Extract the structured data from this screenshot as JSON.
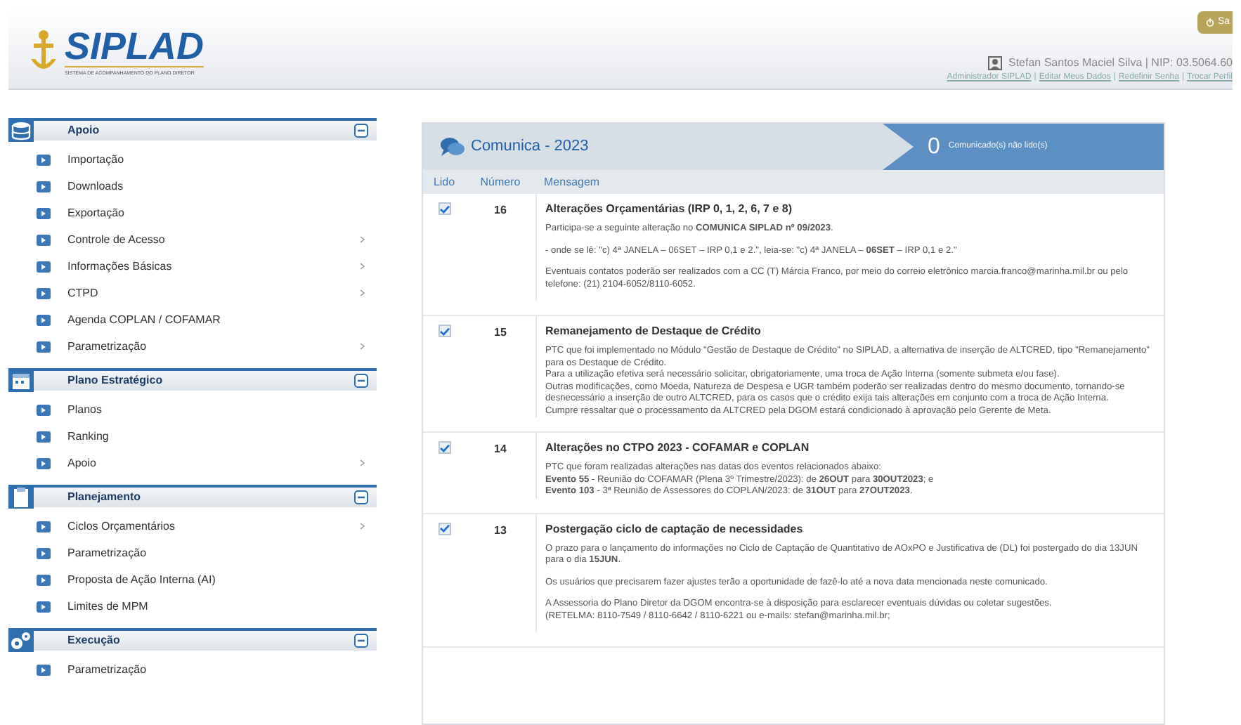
{
  "header": {
    "logo": "SIPLAD",
    "logo_subtitle": "SISTEMA DE ACOMPANHAMENTO DO PLANO DIRETOR",
    "user": "Stefan Santos Maciel Silva | NIP: 03.5064.60",
    "links": [
      "Administrador SIPLAD",
      "Editar Meus Dados",
      "Redefinir Senha",
      "Trocar Perfil"
    ],
    "link_separators": [
      "|",
      "|",
      "|"
    ],
    "exit_button": "Sa"
  },
  "sidebar": {
    "sections": [
      {
        "title": "Apoio",
        "expanded": true,
        "items": [
          {
            "label": "Importação",
            "has_submenu": false
          },
          {
            "label": "Downloads",
            "has_submenu": false
          },
          {
            "label": "Exportação",
            "has_submenu": false
          },
          {
            "label": "Controle de Acesso",
            "has_submenu": true
          },
          {
            "label": "Informações Básicas",
            "has_submenu": true
          },
          {
            "label": "CTPD",
            "has_submenu": true
          },
          {
            "label": "Agenda COPLAN / COFAMAR",
            "has_submenu": false
          },
          {
            "label": "Parametrização",
            "has_submenu": true
          }
        ]
      },
      {
        "title": "Plano Estratégico",
        "expanded": true,
        "items": [
          {
            "label": "Planos",
            "has_submenu": false
          },
          {
            "label": "Ranking",
            "has_submenu": false
          },
          {
            "label": "Apoio",
            "has_submenu": true
          }
        ]
      },
      {
        "title": "Planejamento",
        "expanded": true,
        "items": [
          {
            "label": "Ciclos Orçamentários",
            "has_submenu": true
          },
          {
            "label": "Parametrização",
            "has_submenu": false
          },
          {
            "label": "Proposta de Ação Interna (AI)",
            "has_submenu": false
          },
          {
            "label": "Limites de MPM",
            "has_submenu": false
          }
        ]
      },
      {
        "title": "Execução",
        "expanded": true,
        "items": [
          {
            "label": "Parametrização",
            "has_submenu": false
          }
        ]
      }
    ]
  },
  "panel": {
    "title": "Comunica - 2023",
    "unread_count": "0",
    "unread_label": "Comunicado(s) não lido(s)",
    "columns": [
      "Lido",
      "Número",
      "Mensagem"
    ],
    "rows": [
      {
        "read": true,
        "number": "16",
        "title": "Alterações Orçamentárias (IRP 0, 1, 2, 6, 7 e 8)",
        "spaced": true,
        "paragraphs": [
          "Participa-se a seguinte alteração no **COMUNICA SIPLAD nº 09/2023**.",
          "- onde se lê: \"c) 4ª JANELA – 06SET – IRP 0,1 e 2.\", leia-se: \"c) 4ª JANELA – **06SET** – IRP 0,1 e 2.\"",
          "Eventuais contatos poderão ser realizados com a CC (T) Márcia Franco, por meio do correio eletrônico marcia.franco@marinha.mil.br ou pelo telefone: (21) 2104-6052/8110-6052."
        ]
      },
      {
        "read": true,
        "number": "15",
        "title": "Remanejamento de Destaque de Crédito",
        "spaced": false,
        "paragraphs": [
          "PTC que foi implementado no Módulo \"Gestão de Destaque de Crédito\" no SIPLAD, a alternativa de inserção de ALTCRED, tipo \"Remanejamento\" para os Destaque de Crédito.",
          "Para a utilização efetiva será necessário solicitar, obrigatoriamente, uma troca de Ação Interna (somente submeta e/ou fase).",
          "Outras modificações, como Moeda, Natureza de Despesa e UGR também poderão ser realizadas dentro do mesmo documento, tornando-se desnecessário a inserção de outro  ALTCRED, para os casos que o crédito exija tais alterações em conjunto com a troca de Ação Interna.",
          "Cumpre ressaltar que o processamento da ALTCRED pela DGOM estará condicionado à aprovação pelo Gerente de Meta."
        ]
      },
      {
        "read": true,
        "number": "14",
        "title": "Alterações no CTPO 2023 - COFAMAR e COPLAN",
        "spaced": false,
        "paragraphs": [
          "PTC que foram realizadas alterações nas datas dos eventos relacionados abaixo:",
          "**Evento 55** - Reunião do COFAMAR (Plena 3º Trimestre/2023): de **26OUT** para **30OUT2023**; e",
          "**Evento 103** - 3ª Reunião de Assessores do COPLAN/2023: de **31OUT** para **27OUT2023**."
        ]
      },
      {
        "read": true,
        "number": "13",
        "title": "Postergação ciclo de captação de necessidades",
        "spaced": true,
        "paragraphs": [
          "O prazo para o lançamento do informações no Ciclo de Captação de Quantitativo de AOxPO e Justificativa de (DL) foi postergado do dia 13JUN para o dia **15JUN**.",
          "Os usuários que precisarem fazer ajustes terão a oportunidade de fazê-lo até a nova data mencionada neste comunicado.",
          "A Assessoria do Plano Diretor da DGOM encontra-se à disposição para esclarecer eventuais dúvidas ou coletar sugestões.\n(RETELMA: 8110-7549 / 8110-6642 / 8110-6221 ou e-mails: stefan@marinha.mil.br;"
        ]
      }
    ]
  }
}
